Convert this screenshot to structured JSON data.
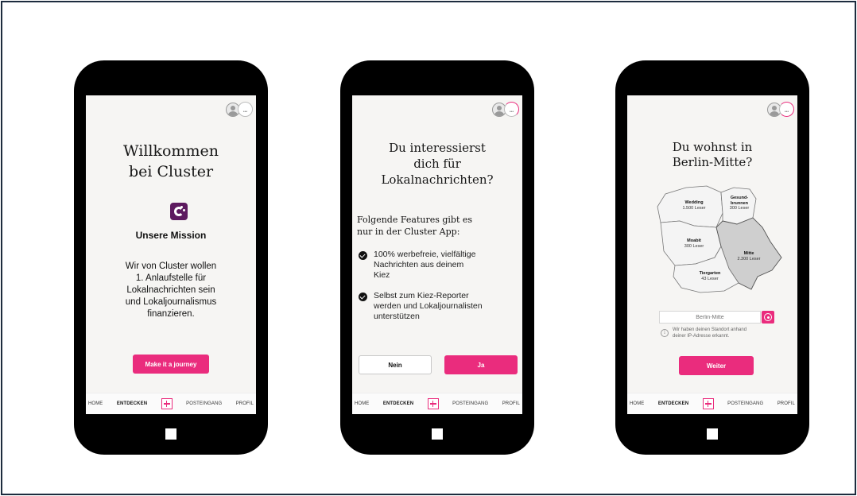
{
  "screens": [
    {
      "title_line1": "Willkommen",
      "title_line2": "bei Cluster",
      "mission_heading": "Unsere Mission",
      "mission_lines": [
        "Wir von Cluster wollen",
        "1. Anlaufstelle für",
        "Lokalnachrichten sein",
        "und Lokaljournalismus",
        "finanzieren."
      ],
      "cta_label": "Make it a journey"
    },
    {
      "title_lines": [
        "Du interessierst",
        "dich für",
        "Lokalnachrichten?"
      ],
      "features_heading_lines": [
        "Folgende Features gibt es",
        "nur in der Cluster App:"
      ],
      "features": [
        {
          "lines": [
            "100% werbefreie, vielfältige",
            "Nachrichten aus deinem",
            "Kiez"
          ]
        },
        {
          "lines": [
            "Selbst zum Kiez-Reporter",
            "werden und Lokaljournalisten",
            "unterstützen"
          ]
        }
      ],
      "no_label": "Nein",
      "yes_label": "Ja"
    },
    {
      "title_lines": [
        "Du wohnst in",
        "Berlin-Mitte?"
      ],
      "districts": [
        {
          "name": "Wedding",
          "readers": "1.500 Leser"
        },
        {
          "name": "Gesund-",
          "name2": "brunnen",
          "readers": "300 Leser"
        },
        {
          "name": "Moabit",
          "readers": "300 Leser"
        },
        {
          "name": "Mitte",
          "readers": "2.300 Leser"
        },
        {
          "name": "Tiergarten",
          "readers": "43 Leser"
        }
      ],
      "location_placeholder": "Berlin-Mitte",
      "info_lines": [
        "Wir haben deinen Standort anhand",
        "deiner IP-Adresse erkannt."
      ],
      "cta_label": "Weiter"
    }
  ],
  "nav": {
    "home": "HOME",
    "discover": "ENTDECKEN",
    "inbox": "POSTEINGANG",
    "profile": "PROFIL"
  },
  "colors": {
    "accent": "#ea2c7d",
    "logo": "#5d1a5f",
    "selected_district": "#cfcfcf"
  },
  "icons": [
    "avatar-icon",
    "progress-ring-icon",
    "cluster-logo-icon",
    "check-icon",
    "plus-icon",
    "target-icon",
    "info-icon"
  ]
}
